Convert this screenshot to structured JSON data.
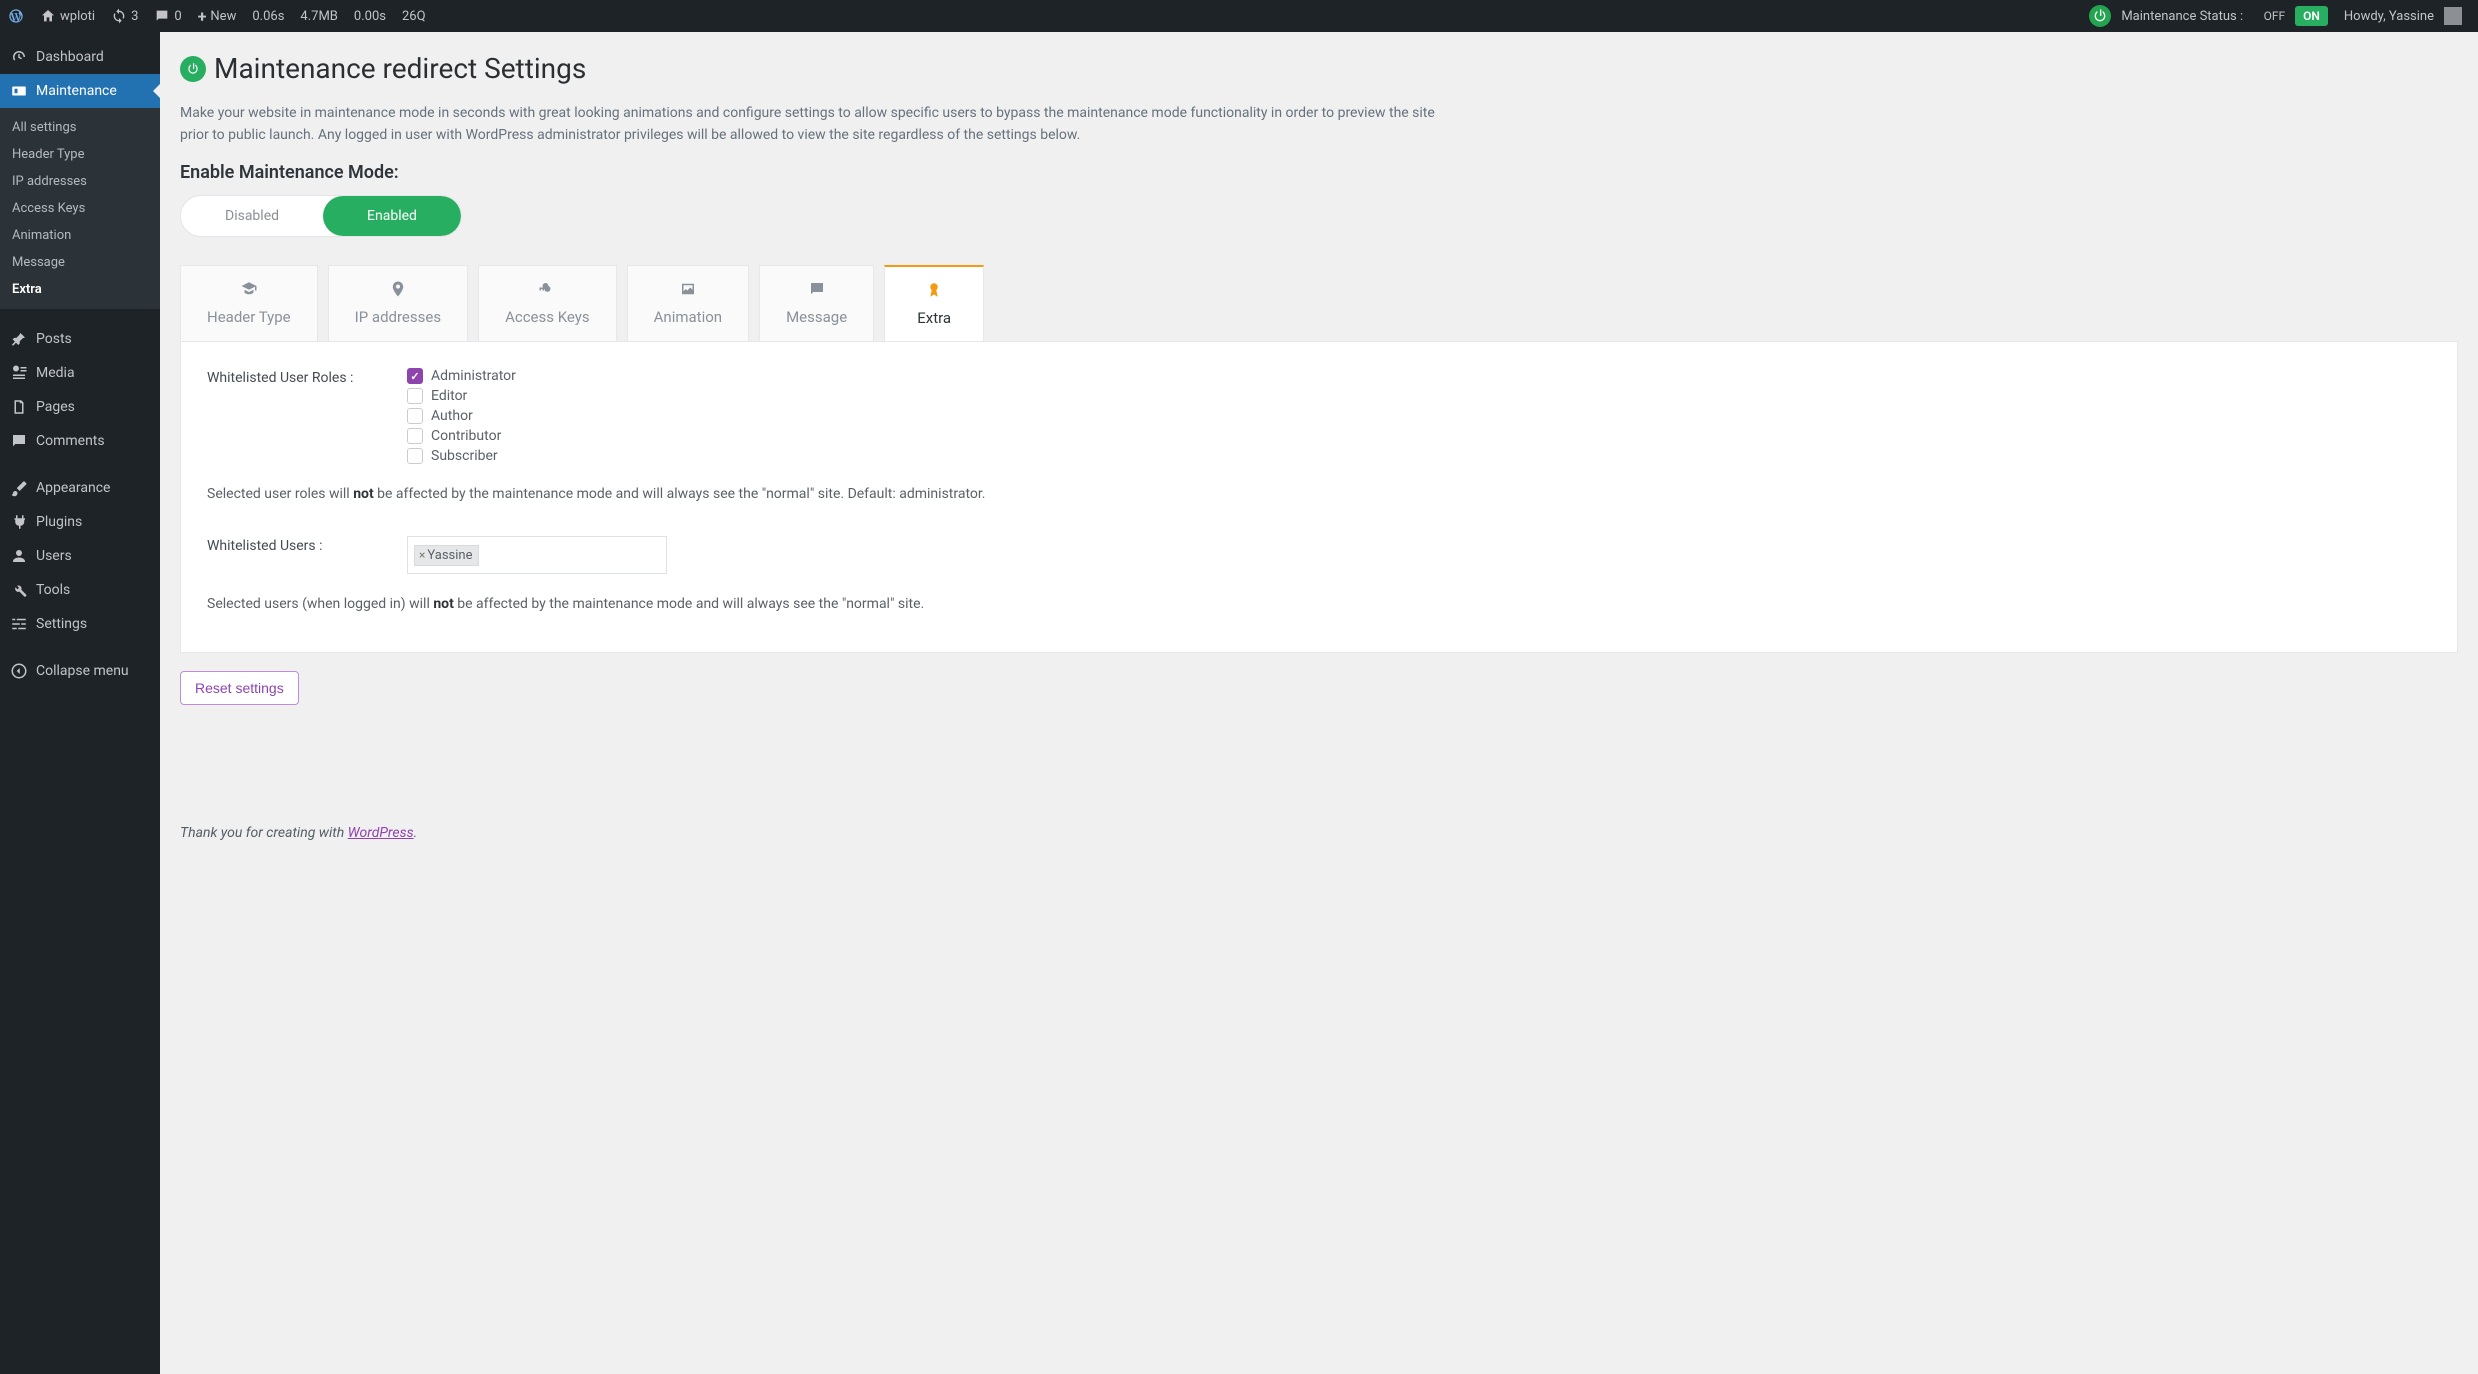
{
  "adminbar": {
    "site_name": "wploti",
    "updates_count": "3",
    "comments_count": "0",
    "new_label": "New",
    "perf_time1": "0.06s",
    "perf_mem": "4.7MB",
    "perf_time2": "0.00s",
    "perf_queries": "26Q",
    "maintenance_status_label": "Maintenance Status :",
    "off_label": "OFF",
    "on_label": "ON",
    "howdy": "Howdy, Yassine"
  },
  "sidebar": {
    "dashboard": "Dashboard",
    "maintenance": "Maintenance",
    "sub": {
      "all_settings": "All settings",
      "header_type": "Header Type",
      "ip_addresses": "IP addresses",
      "access_keys": "Access Keys",
      "animation": "Animation",
      "message": "Message",
      "extra": "Extra"
    },
    "posts": "Posts",
    "media": "Media",
    "pages": "Pages",
    "comments": "Comments",
    "appearance": "Appearance",
    "plugins": "Plugins",
    "users": "Users",
    "tools": "Tools",
    "settings": "Settings",
    "collapse": "Collapse menu"
  },
  "page": {
    "title": "Maintenance redirect Settings",
    "desc": "Make your website in maintenance mode in seconds with great looking animations and configure settings to allow specific users to bypass the maintenance mode functionality in order to preview the site prior to public launch. Any logged in user with WordPress administrator privileges will be allowed to view the site regardless of the settings below.",
    "enable_label": "Enable Maintenance Mode:",
    "disabled": "Disabled",
    "enabled": "Enabled"
  },
  "tabs": {
    "header_type": "Header Type",
    "ip_addresses": "IP addresses",
    "access_keys": "Access Keys",
    "animation": "Animation",
    "message": "Message",
    "extra": "Extra"
  },
  "panel": {
    "roles_label": "Whitelisted User Roles :",
    "roles": {
      "administrator": "Administrator",
      "editor": "Editor",
      "author": "Author",
      "contributor": "Contributor",
      "subscriber": "Subscriber"
    },
    "roles_help_pre": "Selected user roles will ",
    "roles_help_bold": "not",
    "roles_help_post": " be affected by the maintenance mode and will always see the \"normal\" site. Default: administrator.",
    "users_label": "Whitelisted Users :",
    "user_tag": "Yassine",
    "users_help_pre": "Selected users (when logged in) will ",
    "users_help_bold": "not",
    "users_help_post": " be affected by the maintenance mode and will always see the \"normal\" site."
  },
  "reset_label": "Reset settings",
  "footer": {
    "pre": "Thank you for creating with ",
    "link": "WordPress",
    "post": "."
  }
}
